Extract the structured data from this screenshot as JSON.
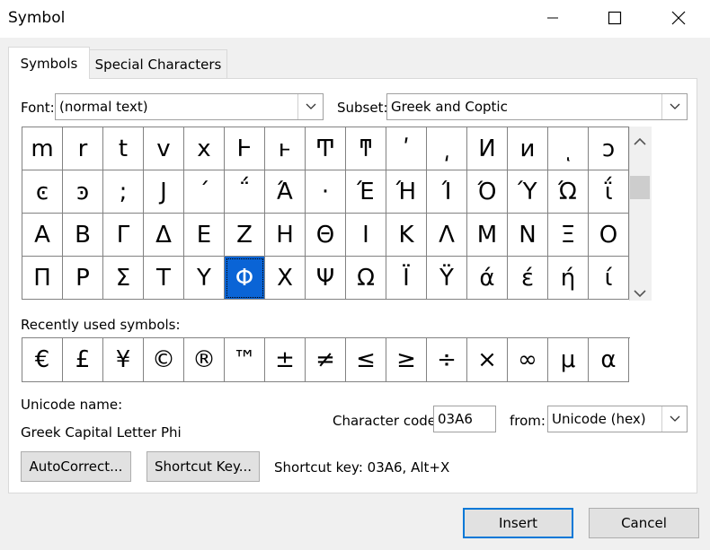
{
  "window": {
    "title": "Symbol"
  },
  "tabs": [
    {
      "label": "Symbols",
      "active": true
    },
    {
      "label": "Special Characters",
      "active": false
    }
  ],
  "font": {
    "label": "Font:",
    "value": "(normal text)"
  },
  "subset": {
    "label": "Subset:",
    "value": "Greek and Coptic"
  },
  "symbol_grid": [
    [
      "m",
      "r",
      "t",
      "v",
      "x",
      "Ͱ",
      "ͱ",
      "Ͳ",
      "ͳ",
      "ʹ",
      "͵",
      "Ͷ",
      "ͷ",
      "ͺ",
      "ͻ"
    ],
    [
      "ͼ",
      "ͽ",
      ";",
      "Ϳ",
      "΄",
      "΅",
      "Ά",
      "·",
      "Έ",
      "Ή",
      "Ί",
      "Ό",
      "Ύ",
      "Ώ",
      "ΐ"
    ],
    [
      "Α",
      "Β",
      "Γ",
      "Δ",
      "Ε",
      "Ζ",
      "Η",
      "Θ",
      "Ι",
      "Κ",
      "Λ",
      "Μ",
      "Ν",
      "Ξ",
      "Ο"
    ],
    [
      "Π",
      "Ρ",
      "Σ",
      "Τ",
      "Υ",
      "Φ",
      "Χ",
      "Ψ",
      "Ω",
      "Ϊ",
      "Ϋ",
      "ά",
      "έ",
      "ή",
      "ί"
    ]
  ],
  "selected": {
    "row": 3,
    "col": 5
  },
  "recent": {
    "label": "Recently used symbols:",
    "symbols": [
      "€",
      "£",
      "¥",
      "©",
      "®",
      "™",
      "±",
      "≠",
      "≤",
      "≥",
      "÷",
      "×",
      "∞",
      "μ",
      "α"
    ]
  },
  "unicode_name": {
    "label": "Unicode name:",
    "value": "Greek Capital Letter Phi"
  },
  "char_code": {
    "label": "Character code:",
    "value": "03A6"
  },
  "from": {
    "label": "from:",
    "value": "Unicode (hex)"
  },
  "buttons": {
    "autocorrect": "AutoCorrect...",
    "shortcut_key": "Shortcut Key...",
    "insert": "Insert",
    "cancel": "Cancel"
  },
  "shortcut_text": "Shortcut key: 03A6, Alt+X",
  "icons": {
    "minimize": "minimize-icon",
    "maximize": "maximize-icon",
    "close": "close-icon"
  }
}
